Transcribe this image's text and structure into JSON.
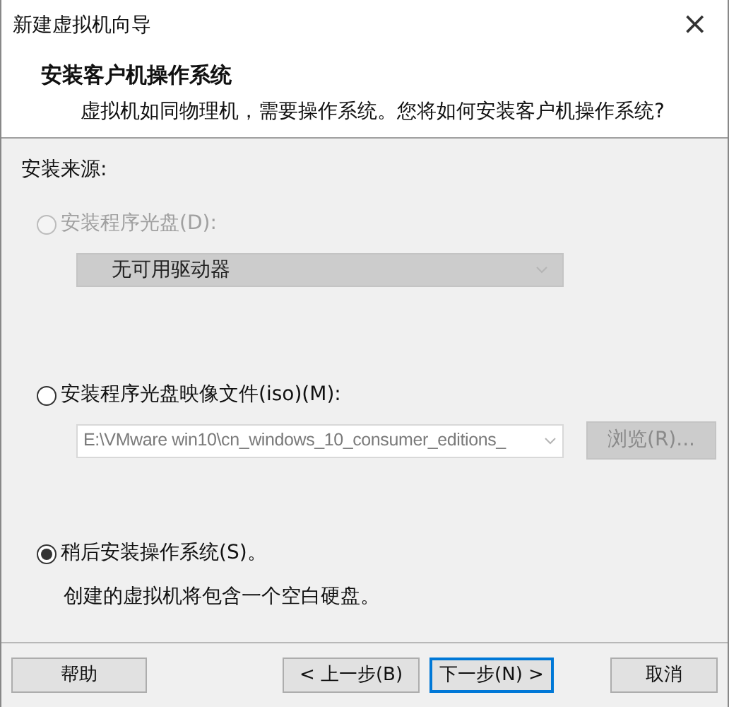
{
  "window": {
    "title": "新建虚拟机向导",
    "close": "×"
  },
  "header": {
    "title": "安装客户机操作系统",
    "subtitle": "虚拟机如同物理机，需要操作系统。您将如何安装客户机操作系统?"
  },
  "source_label": "安装来源:",
  "options": [
    {
      "kind": "disc",
      "label": "安装程序光盘(D):",
      "selected": false,
      "disabled": true,
      "dropdown": {
        "value": "无可用驱动器",
        "disabled": true
      }
    },
    {
      "kind": "iso",
      "label": "安装程序光盘映像文件(iso)(M):",
      "selected": false,
      "disabled": false,
      "field": {
        "value": "E:\\VMware win10\\cn_windows_10_consumer_editions_",
        "disabled": true
      },
      "browse": {
        "label": "浏览(R)...",
        "disabled": true
      }
    },
    {
      "kind": "later",
      "label": "稍后安装操作系统(S)。",
      "selected": true,
      "disabled": false,
      "description": "创建的虚拟机将包含一个空白硬盘。"
    }
  ],
  "buttons": [
    {
      "label": "帮助",
      "default": false
    },
    {
      "label": "< 上一步(B)",
      "default": false
    },
    {
      "label": "下一步(N) >",
      "default": true
    },
    {
      "label": "取消",
      "default": false
    }
  ]
}
